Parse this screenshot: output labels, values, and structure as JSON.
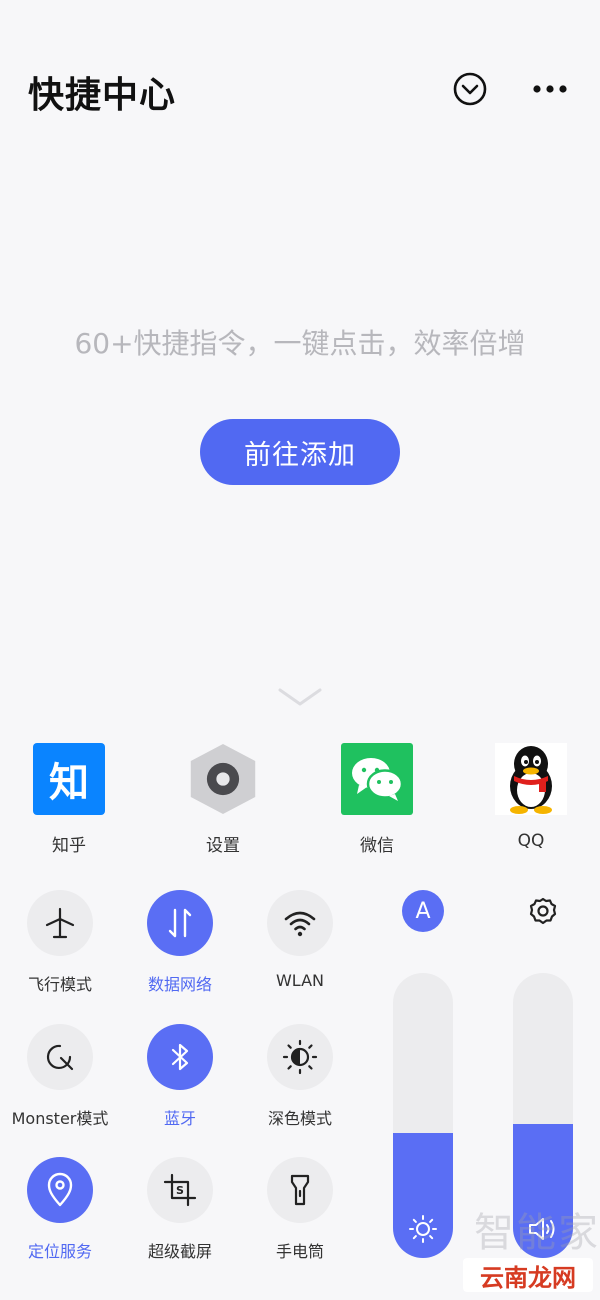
{
  "header": {
    "title": "快捷中心"
  },
  "empty_state": {
    "message": "60+快捷指令，一键点击，效率倍增",
    "add_label": "前往添加"
  },
  "apps": [
    {
      "label": "知乎",
      "icon": "zhihu-icon",
      "glyph": "知"
    },
    {
      "label": "设置",
      "icon": "settings-app-icon"
    },
    {
      "label": "微信",
      "icon": "wechat-icon"
    },
    {
      "label": "QQ",
      "icon": "qq-icon"
    }
  ],
  "toggles": [
    {
      "label": "飞行模式",
      "icon": "airplane-icon",
      "on": false
    },
    {
      "label": "数据网络",
      "icon": "mobile-data-icon",
      "on": true
    },
    {
      "label": "WLAN",
      "icon": "wifi-icon",
      "on": false
    },
    {
      "label": "Monster模式",
      "icon": "monster-mode-icon",
      "on": false
    },
    {
      "label": "蓝牙",
      "icon": "bluetooth-icon",
      "on": true
    },
    {
      "label": "深色模式",
      "icon": "dark-mode-icon",
      "on": false
    },
    {
      "label": "定位服务",
      "icon": "location-icon",
      "on": true
    },
    {
      "label": "超级截屏",
      "icon": "screenshot-crop-icon",
      "on": false
    },
    {
      "label": "手电筒",
      "icon": "flashlight-icon",
      "on": false
    }
  ],
  "sliders": {
    "brightness": {
      "auto_label": "A",
      "level": 0.44,
      "icon": "brightness-icon"
    },
    "volume": {
      "level": 0.47,
      "icon": "volume-icon",
      "settings_icon": "gear-icon"
    }
  },
  "watermark": {
    "top": "智能家",
    "bottom": "云南龙网"
  },
  "colors": {
    "accent": "#5a6ef4",
    "tile_off": "#ececee",
    "background": "#f7f7f9"
  }
}
